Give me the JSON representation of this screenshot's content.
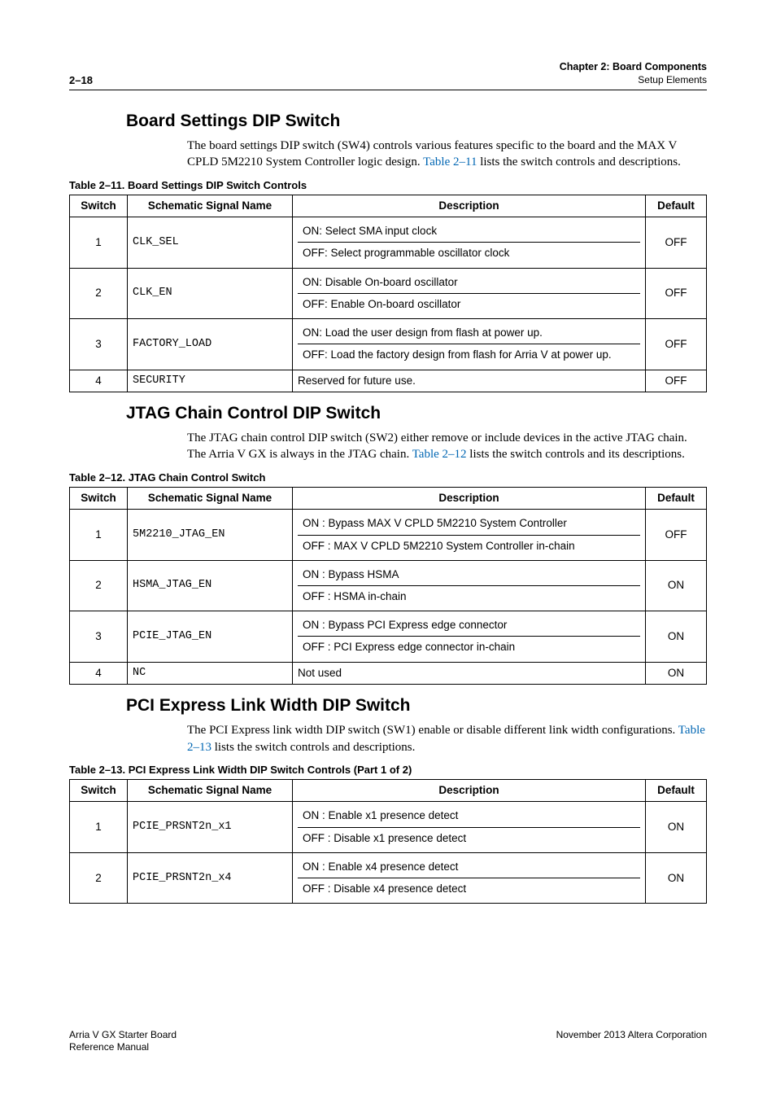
{
  "header": {
    "page_number": "2–18",
    "chapter_line": "Chapter 2: Board Components",
    "sub_line": "Setup Elements"
  },
  "sections": {
    "board": {
      "title": "Board Settings DIP Switch",
      "para_pre": "The board settings DIP switch (SW4) controls various features specific to the board and the MAX V CPLD 5M2210 System Controller logic design. ",
      "para_link": "Table 2–11",
      "para_post": " lists the switch controls and descriptions."
    },
    "jtag": {
      "title": "JTAG Chain Control DIP Switch",
      "para_pre": "The JTAG chain control DIP switch (SW2) either remove or include devices in the active JTAG chain. The Arria V GX is always in the JTAG chain. ",
      "para_link": "Table 2–12",
      "para_post": " lists the switch controls and its descriptions."
    },
    "pcie": {
      "title": "PCI Express Link Width DIP Switch",
      "para_pre": "The PCI Express link width DIP switch (SW1) enable or disable different link width configurations. ",
      "para_link": "Table 2–13",
      "para_post": " lists the switch controls and descriptions."
    }
  },
  "table11": {
    "caption": "Table 2–11.  Board Settings DIP Switch Controls",
    "headers": {
      "switch": "Switch",
      "signal": "Schematic Signal Name",
      "desc": "Description",
      "def": "Default"
    },
    "rows": [
      {
        "switch": "1",
        "signal": "CLK_SEL",
        "on": "ON: Select SMA input clock",
        "off": "OFF: Select programmable oscillator clock",
        "def": "OFF"
      },
      {
        "switch": "2",
        "signal": "CLK_EN",
        "on": "ON: Disable On-board oscillator",
        "off": "OFF: Enable On-board oscillator",
        "def": "OFF"
      },
      {
        "switch": "3",
        "signal": "FACTORY_LOAD",
        "on": "ON: Load the user design from flash at power up.",
        "off": "OFF: Load the factory design from flash for Arria V at power up.",
        "def": "OFF"
      },
      {
        "switch": "4",
        "signal": "SECURITY",
        "single": "Reserved for future use.",
        "def": "OFF"
      }
    ]
  },
  "table12": {
    "caption": "Table 2–12.  JTAG Chain Control Switch",
    "headers": {
      "switch": "Switch",
      "signal": "Schematic Signal Name",
      "desc": "Description",
      "def": "Default"
    },
    "rows": [
      {
        "switch": "1",
        "signal": "5M2210_JTAG_EN",
        "on": "ON : Bypass MAX V CPLD 5M2210 System Controller",
        "off": "OFF : MAX V CPLD 5M2210 System Controller in-chain",
        "def": "OFF"
      },
      {
        "switch": "2",
        "signal": "HSMA_JTAG_EN",
        "on": "ON : Bypass HSMA",
        "off": "OFF : HSMA in-chain",
        "def": "ON"
      },
      {
        "switch": "3",
        "signal": "PCIE_JTAG_EN",
        "on": "ON : Bypass PCI Express edge connector",
        "off": "OFF : PCI Express edge connector in-chain",
        "def": "ON"
      },
      {
        "switch": "4",
        "signal": "NC",
        "single": "Not used",
        "def": "ON"
      }
    ]
  },
  "table13": {
    "caption": "Table 2–13.  PCI Express Link Width DIP Switch Controls  (Part 1 of 2)",
    "headers": {
      "switch": "Switch",
      "signal": "Schematic Signal Name",
      "desc": "Description",
      "def": "Default"
    },
    "rows": [
      {
        "switch": "1",
        "signal": "PCIE_PRSNT2n_x1",
        "on": "ON : Enable x1 presence detect",
        "off": "OFF : Disable x1 presence detect",
        "def": "ON"
      },
      {
        "switch": "2",
        "signal": "PCIE_PRSNT2n_x4",
        "on": "ON : Enable x4 presence detect",
        "off": "OFF : Disable x4 presence detect",
        "def": "ON"
      }
    ]
  },
  "footer": {
    "left1": "Arria V GX Starter Board",
    "left2": "Reference Manual",
    "right": "November 2013   Altera Corporation"
  }
}
